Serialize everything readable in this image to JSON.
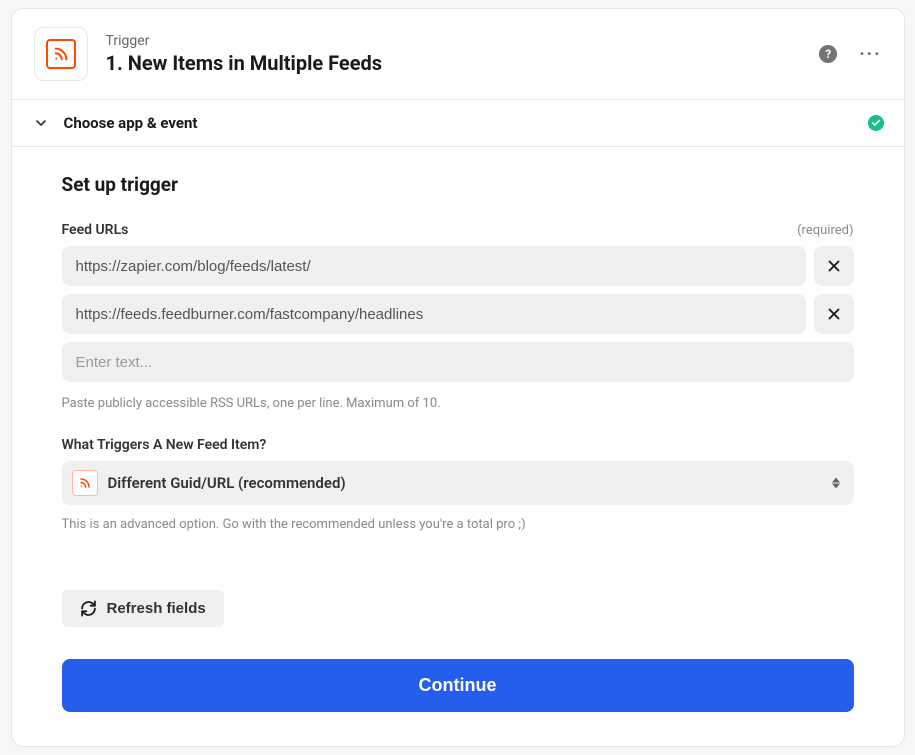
{
  "header": {
    "eyebrow": "Trigger",
    "title": "1. New Items in Multiple Feeds"
  },
  "accordion": {
    "title": "Choose app & event"
  },
  "setup": {
    "heading": "Set up trigger",
    "feed_urls_label": "Feed URLs",
    "required_text": "(required)",
    "urls": [
      "https://zapier.com/blog/feeds/latest/",
      "https://feeds.feedburner.com/fastcompany/headlines"
    ],
    "url_placeholder": "Enter text...",
    "feed_help": "Paste publicly accessible RSS URLs, one per line. Maximum of 10.",
    "trigger_label": "What Triggers A New Feed Item?",
    "trigger_value": "Different Guid/URL (recommended)",
    "trigger_help": "This is an advanced option. Go with the recommended unless you're a total pro ;)",
    "refresh_label": "Refresh fields",
    "continue_label": "Continue"
  }
}
